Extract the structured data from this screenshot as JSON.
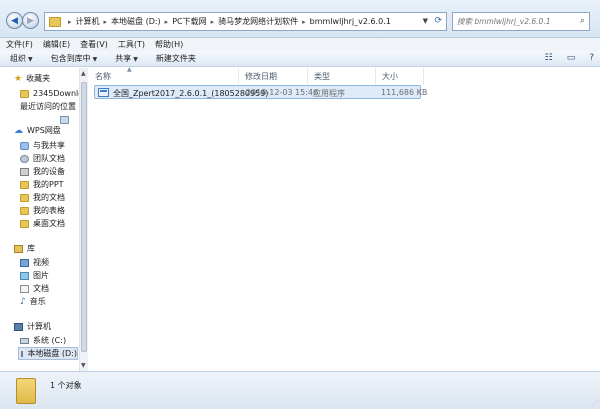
{
  "address": {
    "crumbs": [
      "计算机",
      "本地磁盘 (D:)",
      "PC下载网",
      "骑马梦龙网络计划软件",
      "bmmlwljhrj_v2.6.0.1"
    ]
  },
  "search": {
    "placeholder": "搜索 bmmlwljhrj_v2.6.0.1"
  },
  "menubar": [
    "文件(F)",
    "编辑(E)",
    "查看(V)",
    "工具(T)",
    "帮助(H)"
  ],
  "toolbar": {
    "organize": "组织",
    "include": "包含到库中",
    "share": "共享",
    "new_folder": "新建文件夹"
  },
  "nav": {
    "favorites": "收藏夹",
    "fav_items": [
      "2345Downloads",
      "最近访问的位置"
    ],
    "wps": "WPS网盘",
    "wps_items": [
      "与我共享",
      "团队文档",
      "我的设备",
      "我的PPT",
      "我的文档",
      "我的表格",
      "桌面文档"
    ],
    "library": "库",
    "lib_items": [
      "视频",
      "图片",
      "文档",
      "音乐"
    ],
    "computer": "计算机",
    "drives": [
      "系统 (C:)",
      "本地磁盘 (D:)"
    ]
  },
  "columns": {
    "name": "名称",
    "date": "修改日期",
    "type": "类型",
    "size": "大小"
  },
  "files": [
    {
      "name": "全国_Zpert2017_2.6.0.1_(1805280959)",
      "date": "2018-12-03 15:46",
      "type": "应用程序",
      "size": "111,686 KB"
    }
  ],
  "status": {
    "count": "1 个对象"
  }
}
